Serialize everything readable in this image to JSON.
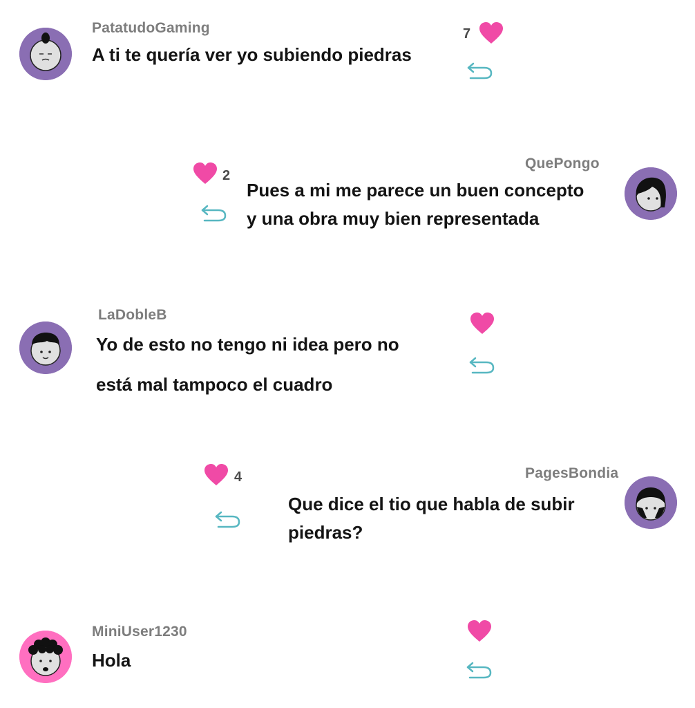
{
  "colors": {
    "avatar_bg": "#8a6eb3",
    "avatar_bg_alt": "#ff6fc0",
    "heart": "#f04aa6",
    "reply": "#57b7c1",
    "username": "#7d7d7d",
    "text": "#141414"
  },
  "comments": [
    {
      "username": "PatatudoGaming",
      "lines": [
        "A ti te quería ver yo subiendo piedras"
      ],
      "likes": "7",
      "avatar_icon": "sleepy-face-icon"
    },
    {
      "username": "QuePongo",
      "lines": [
        "Pues a mi me parece un buen concepto",
        "y una obra muy bien representada"
      ],
      "likes": "2",
      "avatar_icon": "long-hair-face-icon"
    },
    {
      "username": "LaDobleB",
      "lines": [
        "Yo de esto no tengo ni idea pero no",
        "está mal tampoco el cuadro"
      ],
      "likes": "",
      "avatar_icon": "short-hair-face-icon"
    },
    {
      "username": "PagesBondia",
      "lines": [
        "Que dice el tio que habla de subir",
        "piedras?"
      ],
      "likes": "4",
      "avatar_icon": "helmet-hair-face-icon"
    },
    {
      "username": "MiniUser1230",
      "lines": [
        "Hola"
      ],
      "likes": "",
      "avatar_icon": "curly-hair-face-icon"
    }
  ]
}
